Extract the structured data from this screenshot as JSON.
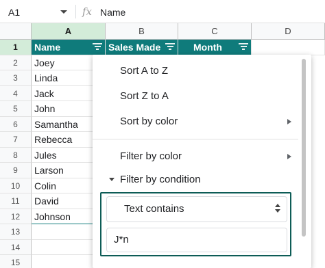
{
  "formula_bar": {
    "cell_ref": "A1",
    "fx": "fx",
    "content": "Name"
  },
  "columns": [
    "A",
    "B",
    "C",
    "D"
  ],
  "rows": [
    "1",
    "2",
    "3",
    "4",
    "5",
    "6",
    "7",
    "8",
    "9",
    "10",
    "11",
    "12",
    "13",
    "14",
    "15"
  ],
  "headers": {
    "name": "Name",
    "sales": "Sales Made",
    "month": "Month"
  },
  "names": [
    "Joey",
    "Linda",
    "Jack",
    "John",
    "Samantha",
    "Rebecca",
    "Jules",
    "Larson",
    "Colin",
    "David",
    "Johnson"
  ],
  "menu": {
    "sort_az": "Sort A to Z",
    "sort_za": "Sort Z to A",
    "sort_by_color": "Sort by color",
    "filter_by_color": "Filter by color",
    "filter_by_condition": "Filter by condition",
    "condition_value": "Text contains",
    "condition_input": "J*n"
  },
  "colors": {
    "header_fill": "#0f7b7b",
    "selection_header": "#d3ecd9",
    "condition_border": "#0d5c56"
  }
}
